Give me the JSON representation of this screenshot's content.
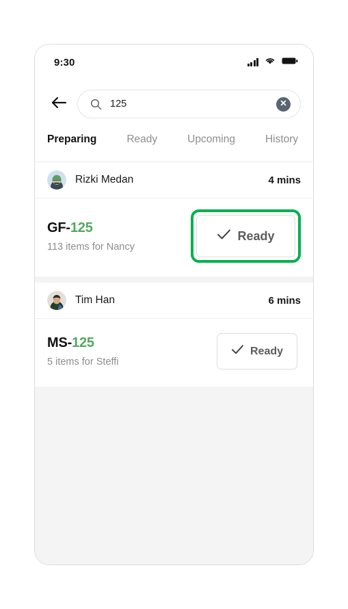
{
  "status_bar": {
    "time": "9:30",
    "icons": [
      "signal-icon",
      "wifi-icon",
      "battery-icon"
    ]
  },
  "search": {
    "back_icon": "back-arrow-icon",
    "search_icon": "search-icon",
    "value": "125",
    "placeholder": "Search",
    "clear_icon": "clear-circle-icon"
  },
  "tabs": [
    {
      "label": "Preparing",
      "active": true
    },
    {
      "label": "Ready",
      "active": false
    },
    {
      "label": "Upcoming",
      "active": false
    },
    {
      "label": "History",
      "active": false
    }
  ],
  "orders": [
    {
      "driver_name": "Rizki Medan",
      "eta": "4 mins",
      "code_prefix": "GF-",
      "code_number": "125",
      "items_text": "113 items for Nancy",
      "action_label": "Ready",
      "action_icon": "check-icon",
      "highlighted": true
    },
    {
      "driver_name": "Tim Han",
      "eta": "6 mins",
      "code_prefix": "MS-",
      "code_number": "125",
      "items_text": "5 items for Steffi",
      "action_label": "Ready",
      "action_icon": "check-icon",
      "highlighted": false
    }
  ],
  "colors": {
    "brand_green": "#02b14f",
    "code_green": "#4faa5c",
    "screen_bg": "#f4f4f4",
    "card_bg": "#ffffff",
    "muted_text": "#8d8d8d"
  }
}
